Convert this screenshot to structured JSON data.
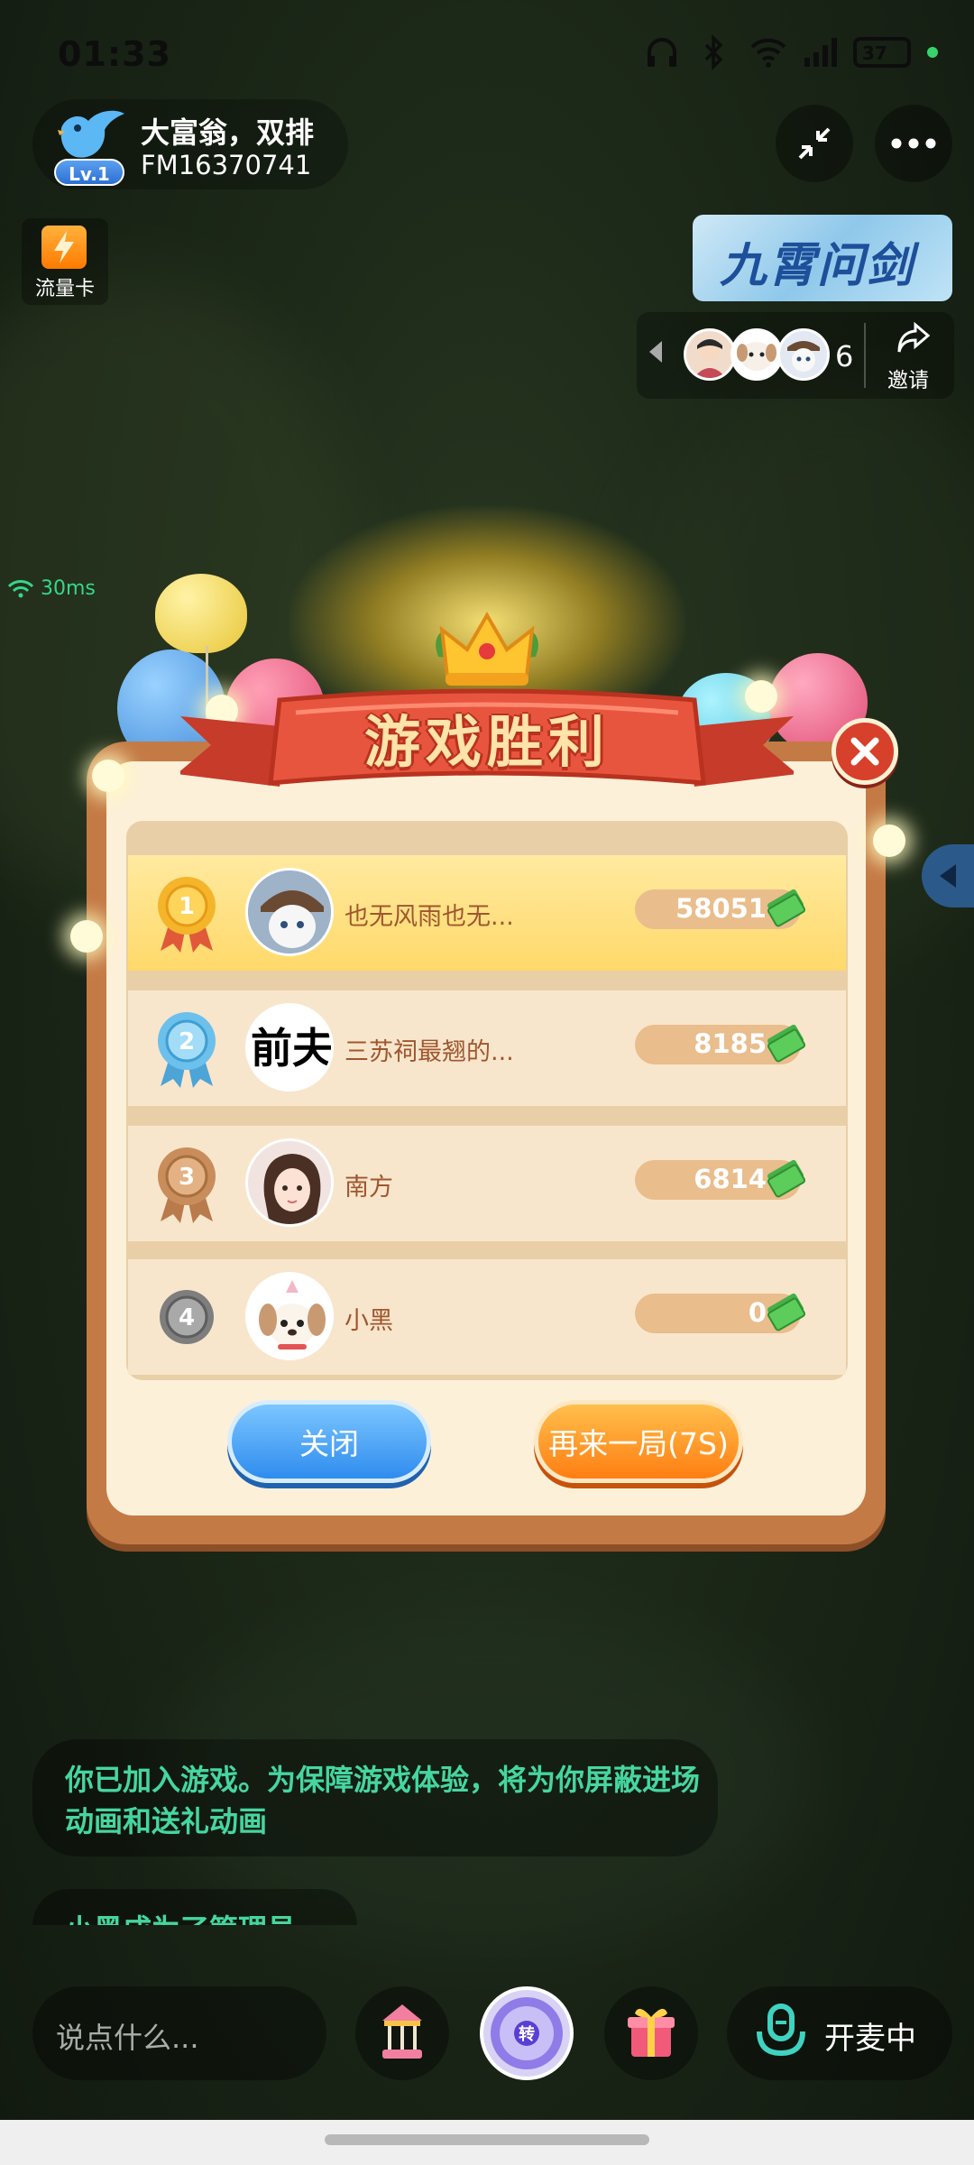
{
  "status_bar": {
    "time": "01:33",
    "battery": "37"
  },
  "room": {
    "title": "大富翁，双排",
    "id": "FM16370741",
    "level": "Lv.1"
  },
  "flow_card": {
    "label": "流量卡"
  },
  "game_banner": {
    "title": "九霄问剑"
  },
  "audience": {
    "count": "6",
    "invite_label": "邀请"
  },
  "ping": {
    "value": "30ms"
  },
  "result": {
    "title": "游戏胜利",
    "rows": [
      {
        "rank": "1",
        "name": "也无风雨也无...",
        "score": "58051"
      },
      {
        "rank": "2",
        "name": "三苏祠最翘的...",
        "score": "8185",
        "avatar_text": "前夫"
      },
      {
        "rank": "3",
        "name": "南方",
        "score": "6814"
      },
      {
        "rank": "4",
        "name": "小黑",
        "score": "0"
      }
    ],
    "close_label": "关闭",
    "again_label": "再来一局(7S)"
  },
  "chat": {
    "message_1": "你已加入游戏。为保障游戏体验，将为你屏蔽进场动画和送礼动画",
    "message_2": "小黑成为了管理员"
  },
  "bottom_bar": {
    "input_placeholder": "说点什么...",
    "wheel_label": "转",
    "mic_label": "开麦中"
  },
  "colors": {
    "chat_text": "#45d6a0",
    "dialog_frame": "#c47a45",
    "dialog_bg": "#fdf0d9",
    "first_row": "#ffd96a",
    "close_button": "#2f8cee",
    "again_button": "#ff7e12"
  }
}
